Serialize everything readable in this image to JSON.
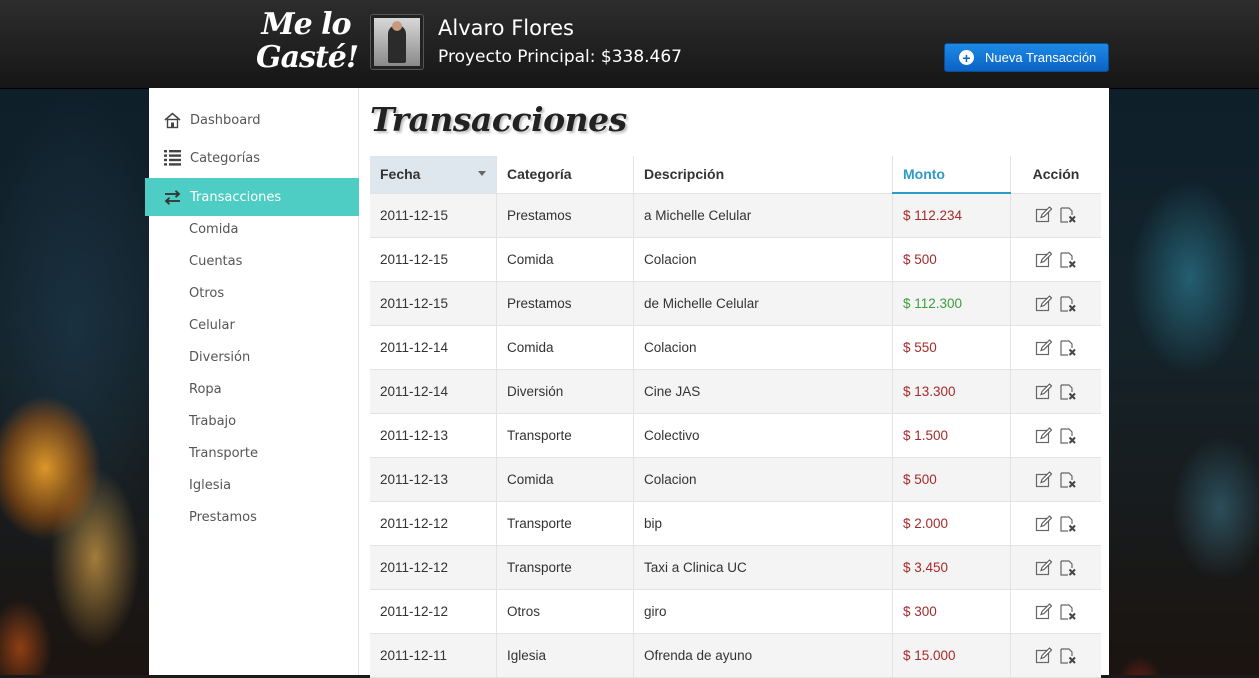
{
  "header": {
    "logo_line1": "Me lo",
    "logo_line2": "Gasté!",
    "user_name": "Alvaro Flores",
    "project_line": "Proyecto Principal: $338.467",
    "new_button_label": "Nueva Transacción"
  },
  "sidebar": {
    "items": [
      {
        "label": "Dashboard",
        "icon": "home-icon"
      },
      {
        "label": "Categorías",
        "icon": "list-icon"
      },
      {
        "label": "Transacciones",
        "icon": "transfer-icon",
        "active": true
      }
    ],
    "categories": [
      "Comida",
      "Cuentas",
      "Otros",
      "Celular",
      "Diversión",
      "Ropa",
      "Trabajo",
      "Transporte",
      "Iglesia",
      "Prestamos"
    ]
  },
  "main": {
    "title": "Transacciones",
    "columns": [
      "Fecha",
      "Categoría",
      "Descripción",
      "Monto",
      "Acción"
    ],
    "rows": [
      {
        "fecha": "2011-12-15",
        "categoria": "Prestamos",
        "descripcion": "a Michelle Celular",
        "monto": "$ 112.234",
        "type": "expense"
      },
      {
        "fecha": "2011-12-15",
        "categoria": "Comida",
        "descripcion": "Colacion",
        "monto": "$ 500",
        "type": "expense"
      },
      {
        "fecha": "2011-12-15",
        "categoria": "Prestamos",
        "descripcion": "de Michelle Celular",
        "monto": "$ 112.300",
        "type": "income"
      },
      {
        "fecha": "2011-12-14",
        "categoria": "Comida",
        "descripcion": "Colacion",
        "monto": "$ 550",
        "type": "expense"
      },
      {
        "fecha": "2011-12-14",
        "categoria": "Diversión",
        "descripcion": "Cine JAS",
        "monto": "$ 13.300",
        "type": "expense"
      },
      {
        "fecha": "2011-12-13",
        "categoria": "Transporte",
        "descripcion": "Colectivo",
        "monto": "$ 1.500",
        "type": "expense"
      },
      {
        "fecha": "2011-12-13",
        "categoria": "Comida",
        "descripcion": "Colacion",
        "monto": "$ 500",
        "type": "expense"
      },
      {
        "fecha": "2011-12-12",
        "categoria": "Transporte",
        "descripcion": "bip",
        "monto": "$ 2.000",
        "type": "expense"
      },
      {
        "fecha": "2011-12-12",
        "categoria": "Transporte",
        "descripcion": "Taxi a Clinica UC",
        "monto": "$ 3.450",
        "type": "expense"
      },
      {
        "fecha": "2011-12-12",
        "categoria": "Otros",
        "descripcion": "giro",
        "monto": "$ 300",
        "type": "expense"
      },
      {
        "fecha": "2011-12-11",
        "categoria": "Iglesia",
        "descripcion": "Ofrenda de ayuno",
        "monto": "$ 15.000",
        "type": "expense"
      }
    ]
  },
  "colors": {
    "accent": "#4ecdc4",
    "button_blue": "#1478d4",
    "expense": "#a52a2a",
    "income": "#3c9e3c",
    "sorted_header": "#dfe7ee"
  }
}
